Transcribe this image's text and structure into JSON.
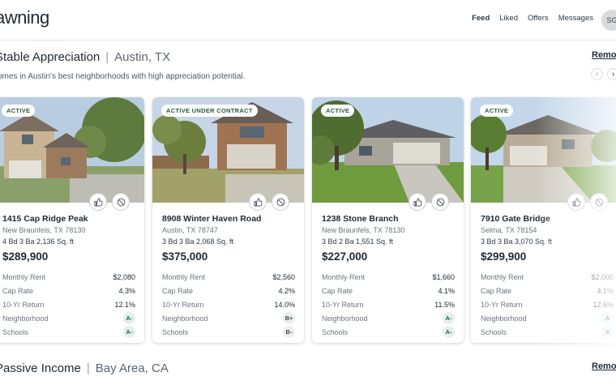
{
  "header": {
    "logo": "awning",
    "nav": [
      "Feed",
      "Liked",
      "Offers",
      "Messages"
    ],
    "avatar": "SG"
  },
  "section1": {
    "title": "Stable Appreciation",
    "location": "Austin, TX",
    "subtitle": "omes in Austin's best neighborhoods with high appreciation potential.",
    "remove": "Remove"
  },
  "section2": {
    "title": "Passive Income",
    "location": "Bay Area, CA",
    "remove": "Remove"
  },
  "labels": {
    "rent": "Monthly Rent",
    "cap": "Cap Rate",
    "ret": "10-Yr Return",
    "hood": "Neighborhood",
    "schools": "Schools"
  },
  "cards": [
    {
      "status": "ACTIVE",
      "address": "1415 Cap Ridge Peak",
      "city": "New Braunfels, TX 78130",
      "specs": "4 Bd 3 Ba  2,136 Sq. ft",
      "price": "$289,900",
      "rent": "$2,080",
      "cap": "4.3%",
      "ret": "12.1%",
      "hood": "A-",
      "schools": "A-"
    },
    {
      "status": "ACTIVE UNDER CONTRACT",
      "address": "8908 Winter Haven Road",
      "city": "Austin, TX 78747",
      "specs": "3 Bd 3 Ba  2,068 Sq. ft",
      "price": "$375,000",
      "rent": "$2,560",
      "cap": "4.2%",
      "ret": "14.0%",
      "hood": "B+",
      "schools": "B-"
    },
    {
      "status": "ACTIVE",
      "address": "1238 Stone Branch",
      "city": "New Braunfels, TX 78130",
      "specs": "3 Bd 2 Ba  1,551 Sq. ft",
      "price": "$227,000",
      "rent": "$1,660",
      "cap": "4.1%",
      "ret": "11.5%",
      "hood": "A-",
      "schools": "A-"
    },
    {
      "status": "ACTIVE",
      "address": "7910 Gate Bridge",
      "city": "Selma, TX 78154",
      "specs": "3 Bd 3 Ba  3,070 Sq. ft",
      "price": "$299,900",
      "rent": "$2,000",
      "cap": "4.1%",
      "ret": "12.6%",
      "hood": "A",
      "schools": "A"
    }
  ],
  "colors": {
    "accent": "#2b5a3b",
    "grade_bg": "#e3f1e8"
  }
}
